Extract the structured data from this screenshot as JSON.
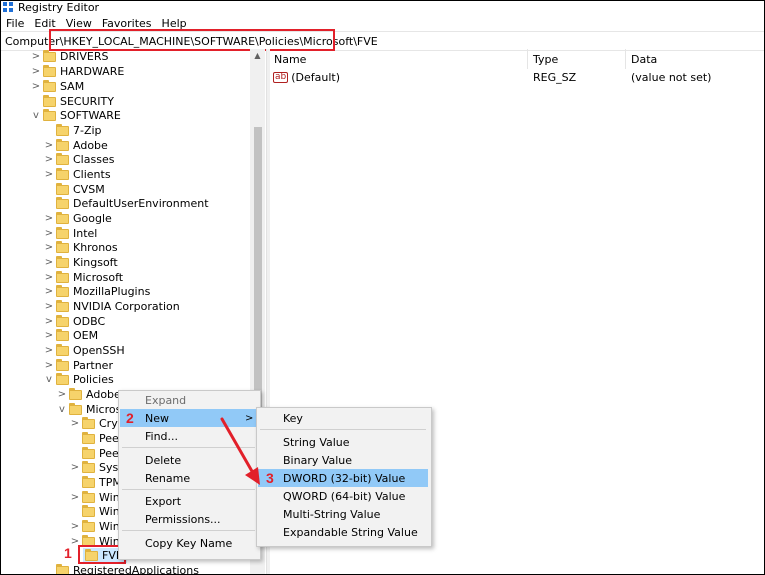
{
  "window": {
    "title": "Registry Editor"
  },
  "menubar": {
    "items": [
      "File",
      "Edit",
      "View",
      "Favorites",
      "Help"
    ]
  },
  "address": {
    "path": "Computer\\HKEY_LOCAL_MACHINE\\SOFTWARE\\Policies\\Microsoft\\FVE"
  },
  "tree": {
    "items": [
      "DRIVERS",
      "HARDWARE",
      "SAM",
      "SECURITY",
      "SOFTWARE",
      "7-Zip",
      "Adobe",
      "Classes",
      "Clients",
      "CVSM",
      "DefaultUserEnvironment",
      "Google",
      "Intel",
      "Khronos",
      "Kingsoft",
      "Microsoft",
      "MozillaPlugins",
      "NVIDIA Corporation",
      "ODBC",
      "OEM",
      "OpenSSH",
      "Partner",
      "Policies",
      "Adobe",
      "Micros",
      "Cryp",
      "Peer",
      "Peer",
      "Syst",
      "TPM",
      "Win",
      "Win",
      "Win",
      "Win",
      "FVE",
      "RegisteredApplications"
    ]
  },
  "list": {
    "columns": [
      "Name",
      "Type",
      "Data"
    ],
    "rows": [
      {
        "name": "(Default)",
        "type": "REG_SZ",
        "data": "(value not set)"
      }
    ]
  },
  "context_menu": {
    "items": [
      "Expand",
      "New",
      "Find...",
      "Delete",
      "Rename",
      "Export",
      "Permissions...",
      "Copy Key Name"
    ]
  },
  "submenu": {
    "items": [
      "Key",
      "String Value",
      "Binary Value",
      "DWORD (32-bit) Value",
      "QWORD (64-bit) Value",
      "Multi-String Value",
      "Expandable String Value"
    ]
  },
  "annotations": {
    "step1": "1",
    "step2": "2",
    "step3": "3"
  },
  "colors": {
    "highlight": "#91c9f7",
    "annotation": "#e2202a",
    "folder": "#f6d36b",
    "selected": "#cce8ff"
  },
  "icons": {
    "chevron_expand": ">",
    "chevron_collapse": "v",
    "submenu_arrow": ">"
  }
}
